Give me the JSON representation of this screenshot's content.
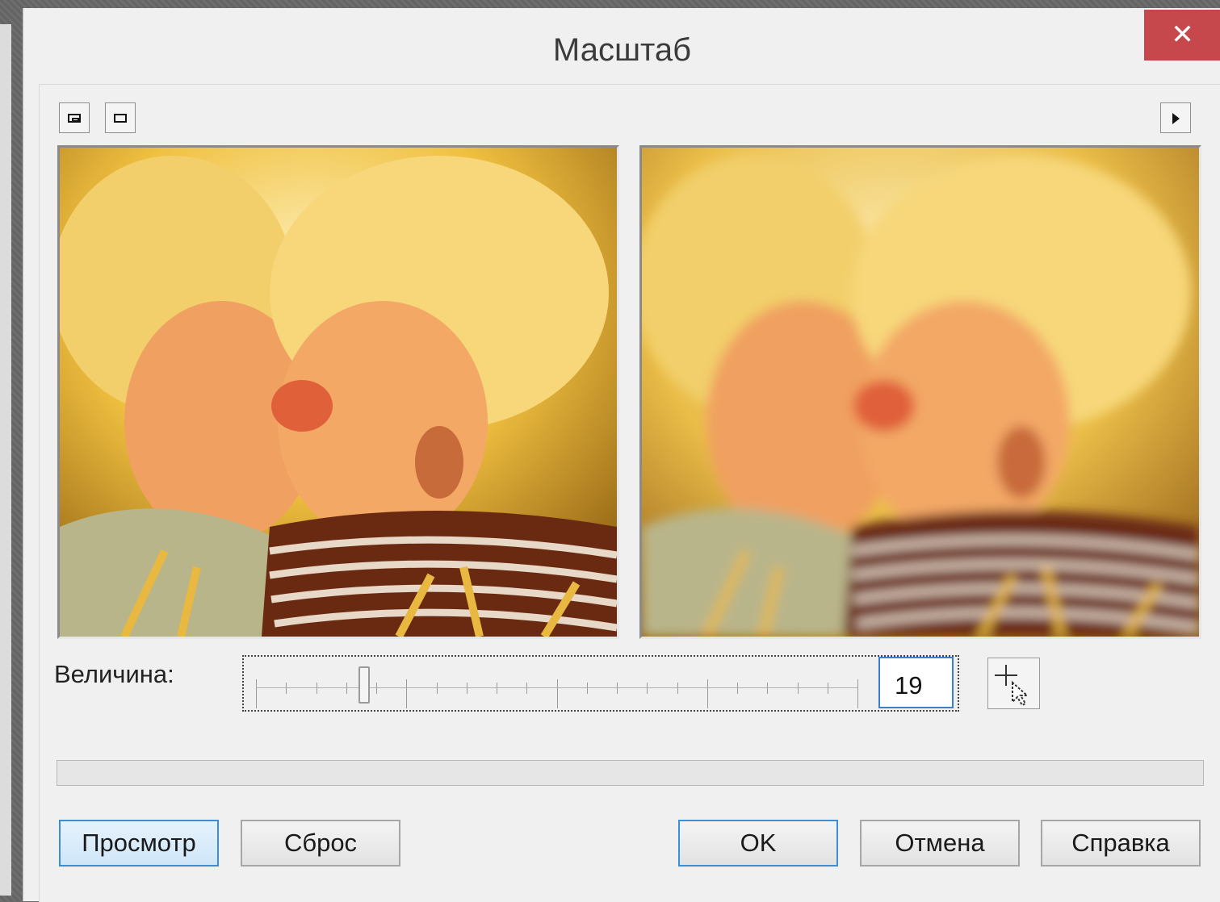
{
  "dialog": {
    "title": "Масштаб",
    "close_glyph": "✕"
  },
  "toolbar": {
    "left_icons": [
      "split-view-icon",
      "single-view-icon"
    ],
    "right_icon": "play-arrow-icon"
  },
  "previews": {
    "left": "original-photo-preview",
    "right": "blurred-photo-preview"
  },
  "amount": {
    "label": "Величина:",
    "value": "19",
    "level": 19,
    "max": 100
  },
  "buttons": {
    "preview": "Просмотр",
    "reset": "Сброс",
    "ok": "OK",
    "cancel": "Отмена",
    "help": "Справка"
  },
  "colors": {
    "close": "#c7484c",
    "focus_blue": "#3c8fd6",
    "dialog_bg": "#f0f0f0"
  }
}
